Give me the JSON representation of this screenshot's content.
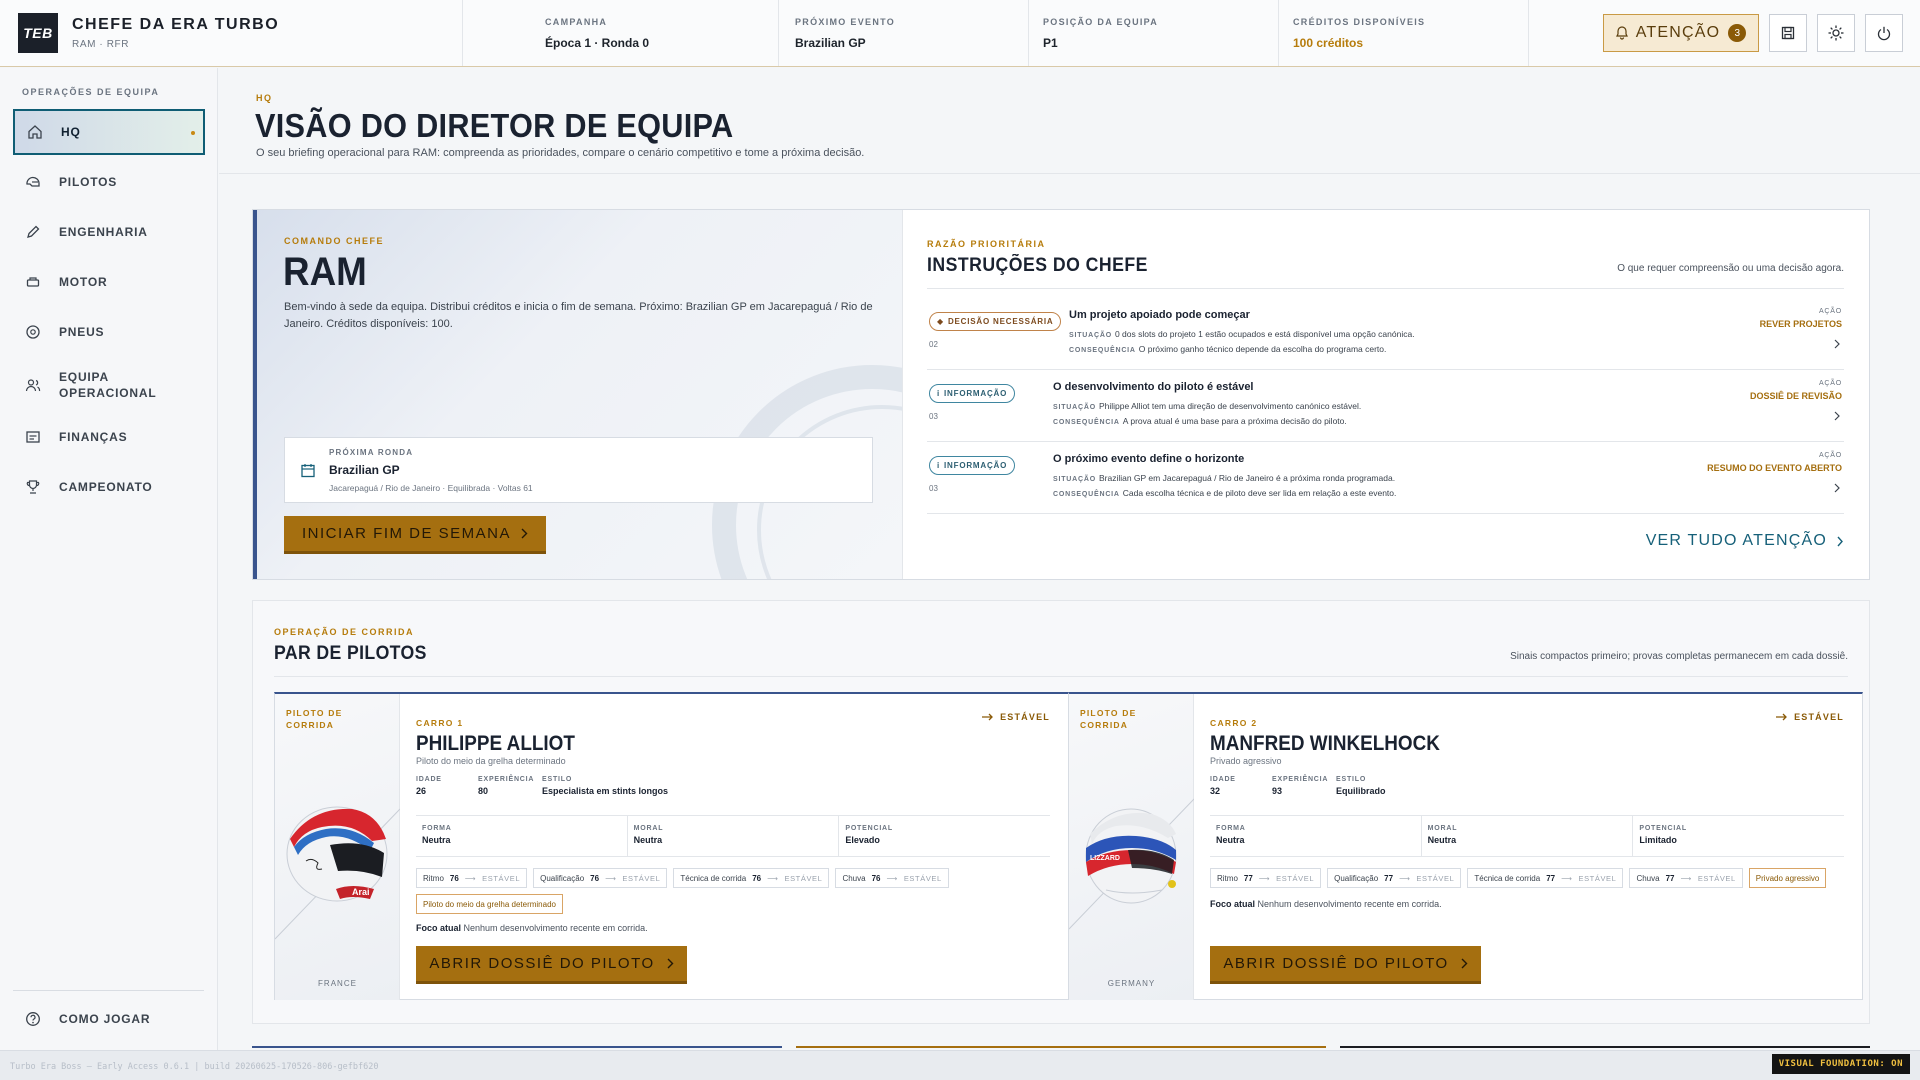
{
  "app": {
    "logo": "TEB",
    "title": "CHEFE DA ERA TURBO",
    "subtitle": "RAM · RFR"
  },
  "stats": [
    {
      "label": "CAMPANHA",
      "value": "Época 1 · Ronda 0"
    },
    {
      "label": "PRÓXIMO EVENTO",
      "value": "Brazilian GP"
    },
    {
      "label": "POSIÇÃO DA EQUIPA",
      "value": "P1"
    },
    {
      "label": "CRÉDITOS DISPONÍVEIS",
      "value": "100 créditos"
    }
  ],
  "actions": {
    "attention_label": "ATENÇÃO",
    "attention_count": "3"
  },
  "sidebar": {
    "heading": "OPERAÇÕES DE EQUIPA",
    "items": [
      {
        "label": "HQ",
        "icon": "home-icon"
      },
      {
        "label": "PILOTOS",
        "icon": "helmet-icon"
      },
      {
        "label": "ENGENHARIA",
        "icon": "pencil-icon"
      },
      {
        "label": "MOTOR",
        "icon": "engine-icon"
      },
      {
        "label": "PNEUS",
        "icon": "tire-icon"
      },
      {
        "label": "EQUIPA OPERACIONAL",
        "icon": "users-icon"
      },
      {
        "label": "FINANÇAS",
        "icon": "finance-icon"
      },
      {
        "label": "CAMPEONATO",
        "icon": "trophy-icon"
      }
    ],
    "help_label": "COMO JOGAR"
  },
  "page": {
    "kicker": "HQ",
    "title": "VISÃO DO DIRETOR DE EQUIPA",
    "description": "O seu briefing operacional para RAM: compreenda as prioridades, compare o cenário competitivo e tome a próxima decisão."
  },
  "command": {
    "kicker": "COMANDO CHEFE",
    "team": "RAM",
    "description": "Bem-vindo à sede da equipa. Distribui créditos e inicia o fim de semana. Próximo: Brazilian GP em Jacarepaguá / Rio de Janeiro. Créditos disponíveis: 100.",
    "next_round_label": "PRÓXIMA RONDA",
    "next_round_name": "Brazilian GP",
    "next_round_meta": "Jacarepaguá / Rio de Janeiro · Equilibrada · Voltas 61",
    "start_button": "INICIAR FIM DE SEMANA"
  },
  "instructions": {
    "kicker": "RAZÃO PRIORITÁRIA",
    "title": "INSTRUÇÕES DO CHEFE",
    "subtitle": "O que requer compreensão ou uma decisão agora.",
    "situation_label": "SITUAÇÃO",
    "consequence_label": "CONSEQUÊNCIA",
    "action_label": "AÇÃO",
    "items": [
      {
        "chip": "DECISÃO NECESSÁRIA",
        "chip_symbol": "◆",
        "num": "02",
        "title": "Um projeto apoiado pode começar",
        "situation": "0 dos slots do projeto 1 estão ocupados e está disponível uma opção canónica.",
        "consequence": "O próximo ganho técnico depende da escolha do programa certo.",
        "action": "REVER PROJETOS"
      },
      {
        "chip": "INFORMAÇÃO",
        "chip_symbol": "i",
        "num": "03",
        "title": "O desenvolvimento do piloto é estável",
        "situation": "Philippe Alliot tem uma direção de desenvolvimento canónico estável.",
        "consequence": "A prova atual é uma base para a próxima decisão do piloto.",
        "action": "DOSSIÊ DE REVISÃO"
      },
      {
        "chip": "INFORMAÇÃO",
        "chip_symbol": "i",
        "num": "03",
        "title": "O próximo evento define o horizonte",
        "situation": "Brazilian GP em Jacarepaguá / Rio de Janeiro é a próxima ronda programada.",
        "consequence": "Cada escolha técnica e de piloto deve ser lida em relação a este evento.",
        "action": "RESUMO DO EVENTO ABERTO"
      }
    ],
    "see_all": "VER TUDO ATENÇÃO"
  },
  "drivers": {
    "kicker": "OPERAÇÃO DE CORRIDA",
    "title": "PAR DE PILOTOS",
    "subtitle": "Sinais compactos primeiro; provas completas permanecem em cada dossiê.",
    "role_label": "PILOTO DE CORRIDA",
    "age_label": "IDADE",
    "exp_label": "EXPERIÊNCIA",
    "style_label": "ESTILO",
    "form_label": "FORMA",
    "morale_label": "MORAL",
    "potential_label": "POTENCIAL",
    "focus_label": "Foco atual",
    "button_label": "ABRIR DOSSIÊ DO PILOTO",
    "list": [
      {
        "car": "CARRO 1",
        "trend": "ESTÁVEL",
        "name": "PHILIPPE ALLIOT",
        "type": "Piloto do meio da grelha determinado",
        "age": "26",
        "experience": "80",
        "style": "Especialista em stints longos",
        "form": "Neutra",
        "morale": "Neutra",
        "potential": "Elevado",
        "country": "FRANCE",
        "chips": [
          {
            "label": "Ritmo",
            "value": "76",
            "state": "ESTÁVEL"
          },
          {
            "label": "Qualificação",
            "value": "76",
            "state": "ESTÁVEL"
          },
          {
            "label": "Técnica de corrida",
            "value": "76",
            "state": "ESTÁVEL"
          },
          {
            "label": "Chuva",
            "value": "76",
            "state": "ESTÁVEL"
          }
        ],
        "tag": "Piloto do meio da grelha determinado",
        "focus": "Nenhum desenvolvimento recente em corrida."
      },
      {
        "car": "CARRO 2",
        "trend": "ESTÁVEL",
        "name": "MANFRED WINKELHOCK",
        "type": "Privado agressivo",
        "age": "32",
        "experience": "93",
        "style": "Equilibrado",
        "form": "Neutra",
        "morale": "Neutra",
        "potential": "Limitado",
        "country": "GERMANY",
        "chips": [
          {
            "label": "Ritmo",
            "value": "77",
            "state": "ESTÁVEL"
          },
          {
            "label": "Qualificação",
            "value": "77",
            "state": "ESTÁVEL"
          },
          {
            "label": "Técnica de corrida",
            "value": "77",
            "state": "ESTÁVEL"
          },
          {
            "label": "Chuva",
            "value": "77",
            "state": "ESTÁVEL"
          }
        ],
        "tag": "Privado agressivo",
        "focus": "Nenhum desenvolvimento recente em corrida."
      }
    ]
  },
  "footer": {
    "build": "Turbo Era Boss — Early Access 0.6.1 | build 20260625-170526-806-gefbf620",
    "badge": "VISUAL FOUNDATION: ON"
  },
  "colors": {
    "accent": "#a56f10",
    "navy": "#39548d",
    "teal": "#166079",
    "amber_text": "#b67c0c"
  }
}
